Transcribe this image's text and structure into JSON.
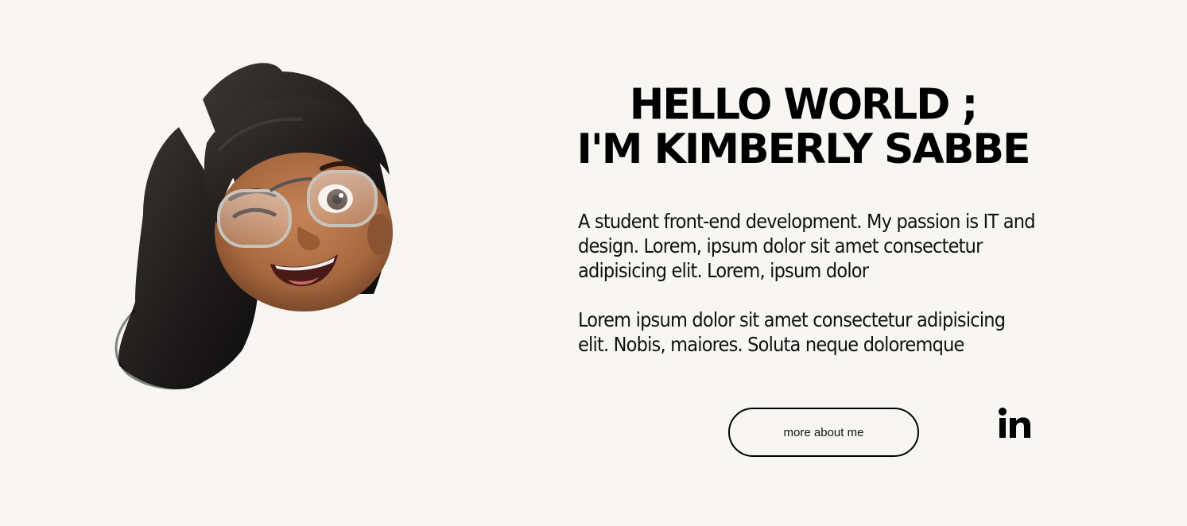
{
  "hero": {
    "title_line_1": "HELLO WORLD ;",
    "title_line_2": "I'M KIMBERLY SABBE",
    "paragraph_1": "A student front-end development. My passion is IT and design. Lorem, ipsum dolor sit amet consectetur adipisicing elit. Lorem, ipsum dolor",
    "paragraph_2": "Lorem ipsum dolor sit amet consectetur adipisicing elit. Nobis, maiores. Soluta neque doloremque",
    "button_label": "more about me",
    "social_icon": "linkedin-icon",
    "avatar_icon": "memoji-avatar"
  },
  "colors": {
    "background": "#f7f6f3",
    "text": "#000000",
    "hair": "#1f1d1c",
    "skin": "#a8683f"
  }
}
